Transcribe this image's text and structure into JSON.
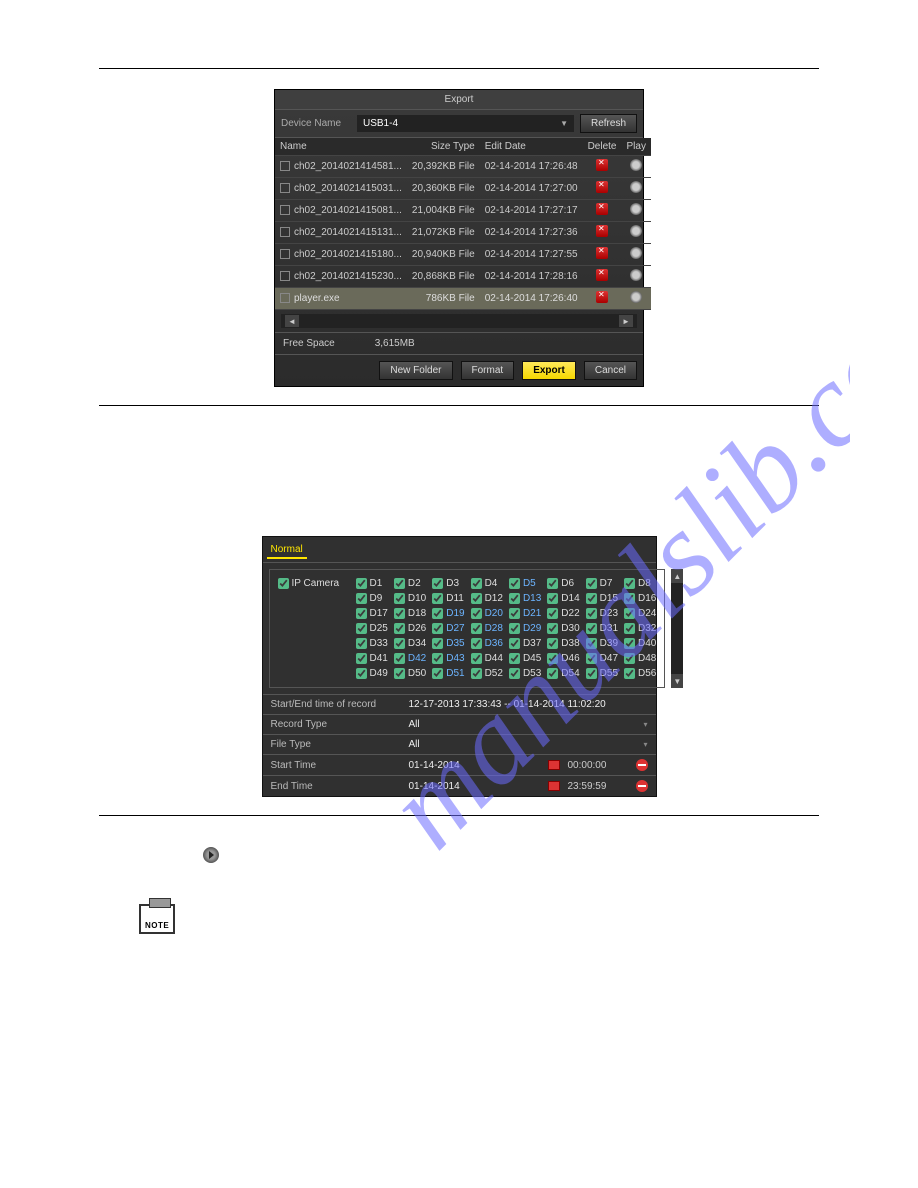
{
  "watermark": "manualslib.com",
  "export_panel": {
    "title": "Export",
    "device_label": "Device Name",
    "device_value": "USB1-4",
    "refresh": "Refresh",
    "headers": {
      "name": "Name",
      "sizetype": "Size Type",
      "editdate": "Edit Date",
      "delete": "Delete",
      "play": "Play"
    },
    "rows": [
      {
        "name": "ch02_2014021414581...",
        "size": "20,392KB File",
        "date": "02-14-2014 17:26:48"
      },
      {
        "name": "ch02_2014021415031...",
        "size": "20,360KB File",
        "date": "02-14-2014 17:27:00"
      },
      {
        "name": "ch02_2014021415081...",
        "size": "21,004KB File",
        "date": "02-14-2014 17:27:17"
      },
      {
        "name": "ch02_2014021415131...",
        "size": "21,072KB File",
        "date": "02-14-2014 17:27:36"
      },
      {
        "name": "ch02_2014021415180...",
        "size": "20,940KB File",
        "date": "02-14-2014 17:27:55"
      },
      {
        "name": "ch02_2014021415230...",
        "size": "20,868KB File",
        "date": "02-14-2014 17:28:16"
      },
      {
        "name": "player.exe",
        "size": "786KB File",
        "date": "02-14-2014 17:26:40",
        "selected": true
      }
    ],
    "free_label": "Free Space",
    "free_value": "3,615MB",
    "buttons": {
      "newfolder": "New Folder",
      "format": "Format",
      "export": "Export",
      "cancel": "Cancel"
    }
  },
  "normal_panel": {
    "tab": "Normal",
    "ipcamera": "IP Camera",
    "cameras": [
      "D1",
      "D2",
      "D3",
      "D4",
      "D5",
      "D6",
      "D7",
      "D8",
      "D9",
      "D10",
      "D11",
      "D12",
      "D13",
      "D14",
      "D15",
      "D16",
      "D17",
      "D18",
      "D19",
      "D20",
      "D21",
      "D22",
      "D23",
      "D24",
      "D25",
      "D26",
      "D27",
      "D28",
      "D29",
      "D30",
      "D31",
      "D32",
      "D33",
      "D34",
      "D35",
      "D36",
      "D37",
      "D38",
      "D39",
      "D40",
      "D41",
      "D42",
      "D43",
      "D44",
      "D45",
      "D46",
      "D47",
      "D48",
      "D49",
      "D50",
      "D51",
      "D52",
      "D53",
      "D54",
      "D55",
      "D56"
    ],
    "blue_indices": [
      4,
      12,
      18,
      19,
      20,
      26,
      27,
      28,
      34,
      35,
      41,
      42,
      50
    ],
    "startend_label": "Start/End time of record",
    "startend_value": "12-17-2013 17:33:43 -- 01-14-2014 11:02:20",
    "recordtype_label": "Record Type",
    "recordtype_value": "All",
    "filetype_label": "File Type",
    "filetype_value": "All",
    "starttime_label": "Start Time",
    "starttime_date": "01-14-2014",
    "starttime_time": "00:00:00",
    "endtime_label": "End Time",
    "endtime_date": "01-14-2014",
    "endtime_time": "23:59:59"
  }
}
